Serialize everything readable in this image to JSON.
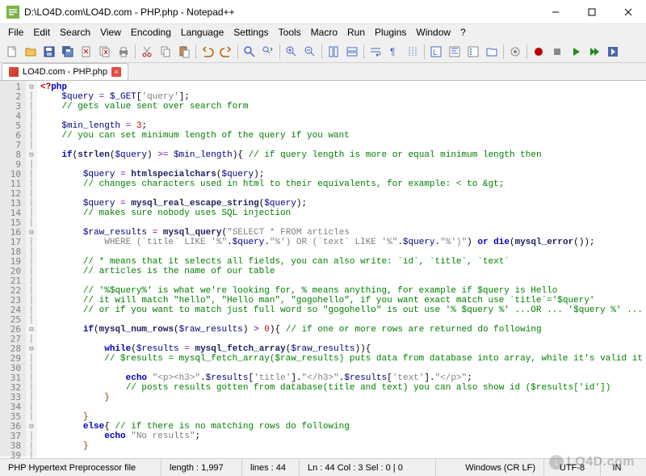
{
  "window": {
    "title": "D:\\LO4D.com\\LO4D.com - PHP.php - Notepad++",
    "app_name": "Notepad++"
  },
  "menus": [
    "File",
    "Edit",
    "Search",
    "View",
    "Encoding",
    "Language",
    "Settings",
    "Tools",
    "Macro",
    "Run",
    "Plugins",
    "Window",
    "?"
  ],
  "tab": {
    "label": "LO4D.com - PHP.php"
  },
  "code_lines": [
    {
      "n": 1,
      "html": "<span class='br'>&lt;?</span><span class='kw'>php</span>"
    },
    {
      "n": 2,
      "html": "    <span class='var'>$query</span> <span class='op'>=</span> <span class='var'>$_GET</span>[<span class='str'>'query'</span>];"
    },
    {
      "n": 3,
      "html": "    <span class='com'>// gets value sent over search form</span>"
    },
    {
      "n": 4,
      "html": ""
    },
    {
      "n": 5,
      "html": "    <span class='var'>$min_length</span> <span class='op'>=</span> <span class='num'>3</span>;"
    },
    {
      "n": 6,
      "html": "    <span class='com'>// you can set minimum length of the query if you want</span>"
    },
    {
      "n": 7,
      "html": ""
    },
    {
      "n": 8,
      "html": "    <span class='kw'>if</span>(<span class='fn'>strlen</span>(<span class='var'>$query</span>) <span class='op'>&gt;=</span> <span class='var'>$min_length</span>){ <span class='com'>// if query length is more or equal minimum length then</span>"
    },
    {
      "n": 9,
      "html": ""
    },
    {
      "n": 10,
      "html": "        <span class='var'>$query</span> <span class='op'>=</span> <span class='fn'>htmlspecialchars</span>(<span class='var'>$query</span>);"
    },
    {
      "n": 11,
      "html": "        <span class='com'>// changes characters used in html to their equivalents, for example: &lt; to &amp;gt;</span>"
    },
    {
      "n": 12,
      "html": ""
    },
    {
      "n": 13,
      "html": "        <span class='var'>$query</span> <span class='op'>=</span> <span class='fn'>mysql_real_escape_string</span>(<span class='var'>$query</span>);"
    },
    {
      "n": 14,
      "html": "        <span class='com'>// makes sure nobody uses SQL injection</span>"
    },
    {
      "n": 15,
      "html": ""
    },
    {
      "n": 16,
      "html": "        <span class='var'>$raw_results</span> <span class='op'>=</span> <span class='fn'>mysql_query</span>(<span class='str'>\"SELECT * FROM articles</span>"
    },
    {
      "n": 17,
      "html": "            <span class='str'>WHERE (`title` LIKE '%\"</span>.<span class='var'>$query</span>.<span class='str'>\"%') OR (`text` LIKE '%\"</span>.<span class='var'>$query</span>.<span class='str'>\"%')\"</span>) <span class='kw'>or</span> <span class='kw'>die</span>(<span class='fn'>mysql_error</span>());"
    },
    {
      "n": 18,
      "html": ""
    },
    {
      "n": 19,
      "html": "        <span class='com'>// * means that it selects all fields, you can also write: `id`, `title`, `text`</span>"
    },
    {
      "n": 20,
      "html": "        <span class='com'>// articles is the name of our table</span>"
    },
    {
      "n": 21,
      "html": ""
    },
    {
      "n": 22,
      "html": "        <span class='com'>// '%$query%' is what we're looking for, % means anything, for example if $query is Hello</span>"
    },
    {
      "n": 23,
      "html": "        <span class='com'>// it will match \"hello\", \"Hello man\", \"gogohello\", if you want exact match use `title`='$query'</span>"
    },
    {
      "n": 24,
      "html": "        <span class='com'>// or if you want to match just full word so \"gogohello\" is out use '% $query %' ...OR ... '$query %' ... OR ... '% $query'</span>"
    },
    {
      "n": 25,
      "html": ""
    },
    {
      "n": 26,
      "html": "        <span class='kw'>if</span>(<span class='fn'>mysql_num_rows</span>(<span class='var'>$raw_results</span>) <span class='op'>&gt;</span> <span class='num'>0</span>){ <span class='com'>// if one or more rows are returned do following</span>"
    },
    {
      "n": 27,
      "html": ""
    },
    {
      "n": 28,
      "html": "            <span class='kw'>while</span>(<span class='var'>$results</span> <span class='op'>=</span> <span class='fn'>mysql_fetch_array</span>(<span class='var'>$raw_results</span>)){"
    },
    {
      "n": 29,
      "html": "            <span class='com'>// $results = mysql_fetch_array($raw_results) puts data from database into array, while it's valid it does the loop</span>"
    },
    {
      "n": 30,
      "html": ""
    },
    {
      "n": 31,
      "html": "                <span class='kw'>echo</span> <span class='str'>\"&lt;p&gt;&lt;h3&gt;\"</span>.<span class='var'>$results</span>[<span class='str'>'title'</span>].<span class='str'>\"&lt;/h3&gt;\"</span>.<span class='var'>$results</span>[<span class='str'>'text'</span>].<span class='str'>\"&lt;/p&gt;\"</span>;"
    },
    {
      "n": 32,
      "html": "                <span class='com'>// posts results gotten from database(title and text) you can also show id ($results['id'])</span>"
    },
    {
      "n": 33,
      "html": "            <span class='br2'>}</span>"
    },
    {
      "n": 34,
      "html": ""
    },
    {
      "n": 35,
      "html": "        <span class='br2'>}</span>"
    },
    {
      "n": 36,
      "html": "        <span class='kw'>else</span>{ <span class='com'>// if there is no matching rows do following</span>"
    },
    {
      "n": 37,
      "html": "            <span class='kw'>echo</span> <span class='str'>\"No results\"</span>;"
    },
    {
      "n": 38,
      "html": "        <span class='br2'>}</span>"
    },
    {
      "n": 39,
      "html": ""
    }
  ],
  "status": {
    "file_type": "PHP Hypertext Preprocessor file",
    "length": "length : 1,997",
    "lines": "lines : 44",
    "pos": "Ln : 44   Col : 3   Sel : 0 | 0",
    "eol": "Windows (CR LF)",
    "encoding": "UTF-8",
    "mode": "IN"
  },
  "watermark": "LO4D.com"
}
